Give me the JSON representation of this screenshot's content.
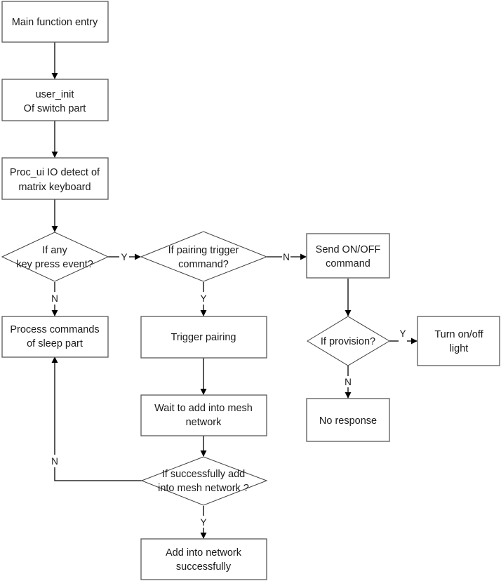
{
  "diagram": {
    "type": "flowchart",
    "nodes": {
      "main_entry": {
        "shape": "process",
        "lines": [
          "Main function entry"
        ]
      },
      "user_init": {
        "shape": "process",
        "lines": [
          "user_init",
          "Of switch part"
        ]
      },
      "proc_ui": {
        "shape": "process",
        "lines": [
          "Proc_ui  IO detect of",
          "matrix keyboard"
        ]
      },
      "key_press": {
        "shape": "decision",
        "lines": [
          "If any",
          "key press event?"
        ]
      },
      "pairing_trigger": {
        "shape": "decision",
        "lines": [
          "If pairing trigger",
          "command?"
        ]
      },
      "send_onoff": {
        "shape": "process",
        "lines": [
          "Send ON/OFF",
          "command"
        ]
      },
      "sleep_cmds": {
        "shape": "process",
        "lines": [
          "Process commands",
          "of sleep part"
        ]
      },
      "trigger_pairing": {
        "shape": "process",
        "lines": [
          "Trigger pairing"
        ]
      },
      "provision": {
        "shape": "decision",
        "lines": [
          "If provision?"
        ]
      },
      "turn_light": {
        "shape": "process",
        "lines": [
          "Turn on/off",
          "light"
        ]
      },
      "wait_mesh": {
        "shape": "process",
        "lines": [
          "Wait to add into mesh",
          "network"
        ]
      },
      "no_response": {
        "shape": "process",
        "lines": [
          "No response"
        ]
      },
      "added_check": {
        "shape": "decision",
        "lines": [
          "If successfully add",
          "into mesh network ?"
        ]
      },
      "added_ok": {
        "shape": "process",
        "lines": [
          "Add into network",
          "successfully"
        ]
      }
    },
    "edges": [
      {
        "from": "main_entry",
        "to": "user_init",
        "label": ""
      },
      {
        "from": "user_init",
        "to": "proc_ui",
        "label": ""
      },
      {
        "from": "proc_ui",
        "to": "key_press",
        "label": ""
      },
      {
        "from": "key_press",
        "to": "pairing_trigger",
        "label": "Y"
      },
      {
        "from": "key_press",
        "to": "sleep_cmds",
        "label": "N"
      },
      {
        "from": "pairing_trigger",
        "to": "send_onoff",
        "label": "N"
      },
      {
        "from": "pairing_trigger",
        "to": "trigger_pairing",
        "label": "Y"
      },
      {
        "from": "send_onoff",
        "to": "provision",
        "label": ""
      },
      {
        "from": "provision",
        "to": "turn_light",
        "label": "Y"
      },
      {
        "from": "provision",
        "to": "no_response",
        "label": "N"
      },
      {
        "from": "trigger_pairing",
        "to": "wait_mesh",
        "label": ""
      },
      {
        "from": "wait_mesh",
        "to": "added_check",
        "label": ""
      },
      {
        "from": "added_check",
        "to": "added_ok",
        "label": "Y"
      },
      {
        "from": "added_check",
        "to": "sleep_cmds",
        "label": "N"
      }
    ]
  }
}
